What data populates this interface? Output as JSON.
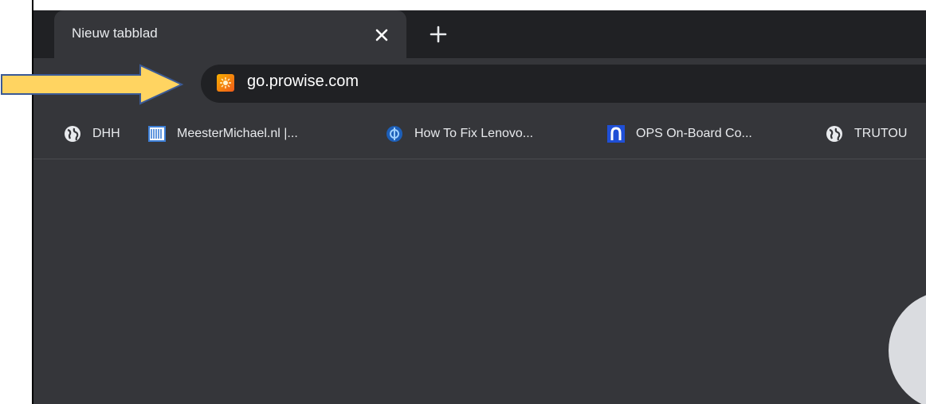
{
  "tab": {
    "title": "Nieuw tabblad"
  },
  "omnibox": {
    "url": "go.prowise.com"
  },
  "bookmarks": [
    {
      "label": "DHH",
      "icon": "globe-icon"
    },
    {
      "label": "MeesterMichael.nl |...",
      "icon": "meestermichael-icon"
    },
    {
      "label": "How To Fix Lenovo...",
      "icon": "lenovo-fix-icon"
    },
    {
      "label": "OPS On-Board Co...",
      "icon": "ops-icon"
    },
    {
      "label": "TRUTOU",
      "icon": "globe-icon"
    }
  ],
  "colors": {
    "tabstrip": "#202124",
    "toolbar": "#35363a",
    "omnibox": "#202124",
    "arrow_fill": "#ffd461",
    "arrow_stroke": "#3b5a96"
  }
}
